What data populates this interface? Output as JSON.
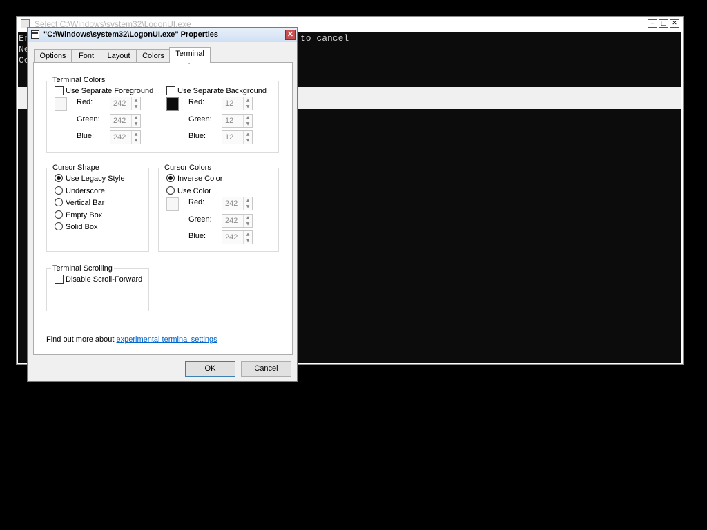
{
  "console": {
    "title": "Select C:\\Windows\\system32\\LogonUI.exe",
    "line1_start": "Er",
    "line2_start": "Ne",
    "line3_start": "Co",
    "line1_end": "to cancel",
    "buttons": {
      "minimize": "–",
      "maximize": "□",
      "close": "✕"
    }
  },
  "dialog": {
    "title": "\"C:\\Windows\\system32\\LogonUI.exe\" Properties",
    "close": "✕",
    "tabs": [
      "Options",
      "Font",
      "Layout",
      "Colors",
      "Terminal"
    ],
    "active_tab": "Terminal",
    "terminal_colors": {
      "label": "Terminal Colors",
      "foreground": {
        "label": "Use Separate Foreground",
        "checked": false,
        "swatch": "#f2f2f2",
        "red_label": "Red:",
        "green_label": "Green:",
        "blue_label": "Blue:",
        "red": "242",
        "green": "242",
        "blue": "242"
      },
      "background": {
        "label": "Use Separate Background",
        "checked": false,
        "swatch": "#0c0c0c",
        "red_label": "Red:",
        "green_label": "Green:",
        "blue_label": "Blue:",
        "red": "12",
        "green": "12",
        "blue": "12"
      }
    },
    "cursor_shape": {
      "label": "Cursor Shape",
      "options": [
        "Use Legacy Style",
        "Underscore",
        "Vertical Bar",
        "Empty Box",
        "Solid Box"
      ],
      "selected": "Use Legacy Style"
    },
    "cursor_colors": {
      "label": "Cursor Colors",
      "options": [
        "Inverse Color",
        "Use Color"
      ],
      "selected": "Inverse Color",
      "swatch": "#f2f2f2",
      "red_label": "Red:",
      "green_label": "Green:",
      "blue_label": "Blue:",
      "red": "242",
      "green": "242",
      "blue": "242"
    },
    "terminal_scrolling": {
      "label": "Terminal Scrolling",
      "option": "Disable Scroll-Forward",
      "checked": false
    },
    "footer": {
      "text": "Find out more about",
      "link": "experimental terminal settings"
    },
    "ok_label": "OK",
    "cancel_label": "Cancel"
  },
  "colors": {
    "console_bg": "#0c0c0c",
    "link": "#0066cc",
    "close_red": "#c75050"
  }
}
